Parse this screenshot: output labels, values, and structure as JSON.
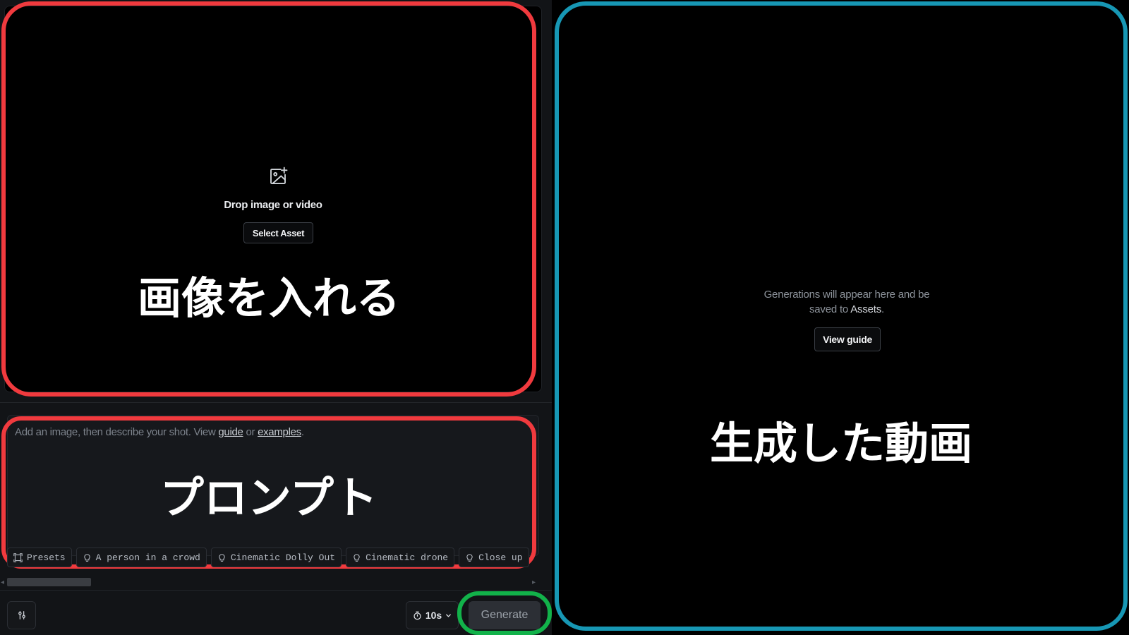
{
  "dropzone": {
    "icon": "image-plus-icon",
    "label": "Drop image or video",
    "select_button": "Select Asset"
  },
  "prompt": {
    "placeholder_prefix": "Add an image, then describe your shot. View ",
    "guide_link": "guide",
    "or_text": " or ",
    "examples_link": "examples",
    "suffix": "."
  },
  "chips": [
    {
      "icon": "presets-icon",
      "label": "Presets"
    },
    {
      "icon": "lightbulb-icon",
      "label": "A person in a crowd"
    },
    {
      "icon": "lightbulb-icon",
      "label": "Cinematic Dolly Out"
    },
    {
      "icon": "lightbulb-icon",
      "label": "Cinematic drone"
    },
    {
      "icon": "lightbulb-icon",
      "label": "Close up"
    }
  ],
  "bottom_bar": {
    "settings_icon": "sliders-icon",
    "duration": "10s",
    "generate_label": "Generate"
  },
  "output": {
    "message_line1": "Generations will appear here and be",
    "message_line2_prefix": "saved to ",
    "message_assets": "Assets",
    "message_line2_suffix": ".",
    "view_guide_label": "View guide"
  },
  "annotations": {
    "image_input": "画像を入れる",
    "prompt": "プロンプト",
    "generated_video": "生成した動画"
  },
  "colors": {
    "annotation_red": "#f03a3e",
    "annotation_green": "#12b24a",
    "annotation_blue": "#1797b4"
  }
}
